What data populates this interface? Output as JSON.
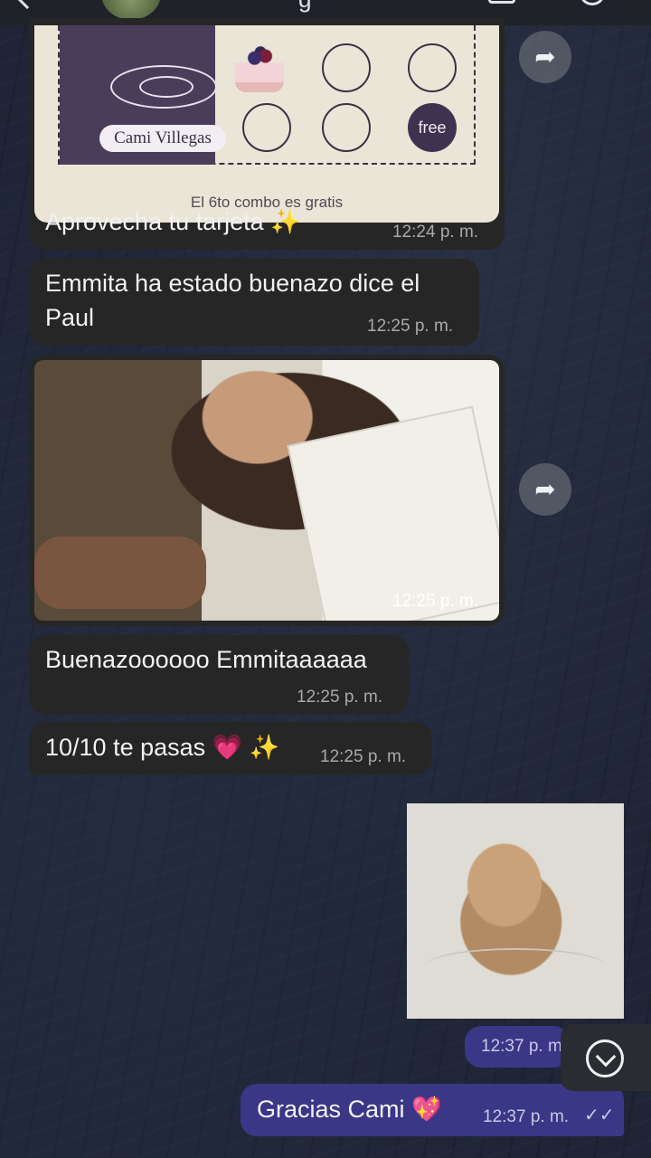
{
  "header": {
    "name_fragment": "g"
  },
  "card": {
    "brand": "Cami Villegas",
    "free_label": "free",
    "footer": "El 6to combo es gratis"
  },
  "messages": [
    {
      "text": "Aprovecha tu tarjeta ✨",
      "time": "12:24 p. m."
    },
    {
      "text": "Emmita ha estado buenazo dice el Paul",
      "time": "12:25 p. m."
    },
    {
      "photo_time": "12:25 p. m."
    },
    {
      "text": "Buenazoooooo Emmitaaaaaa",
      "time": "12:25 p. m."
    },
    {
      "text": "10/10 te pasas 💗 ✨",
      "time": "12:25 p. m."
    },
    {
      "video_time": "12:37 p. m."
    },
    {
      "text": "Gracias Cami 💖",
      "time": "12:37 p. m."
    }
  ],
  "icons": {
    "forward": "forward-icon",
    "scroll": "chevron-down-icon",
    "read": "double-check-icon"
  },
  "colors": {
    "incoming_bubble": "#262626",
    "outgoing_bubble": "#3b3787",
    "card_panel": "#4a3d5a"
  }
}
